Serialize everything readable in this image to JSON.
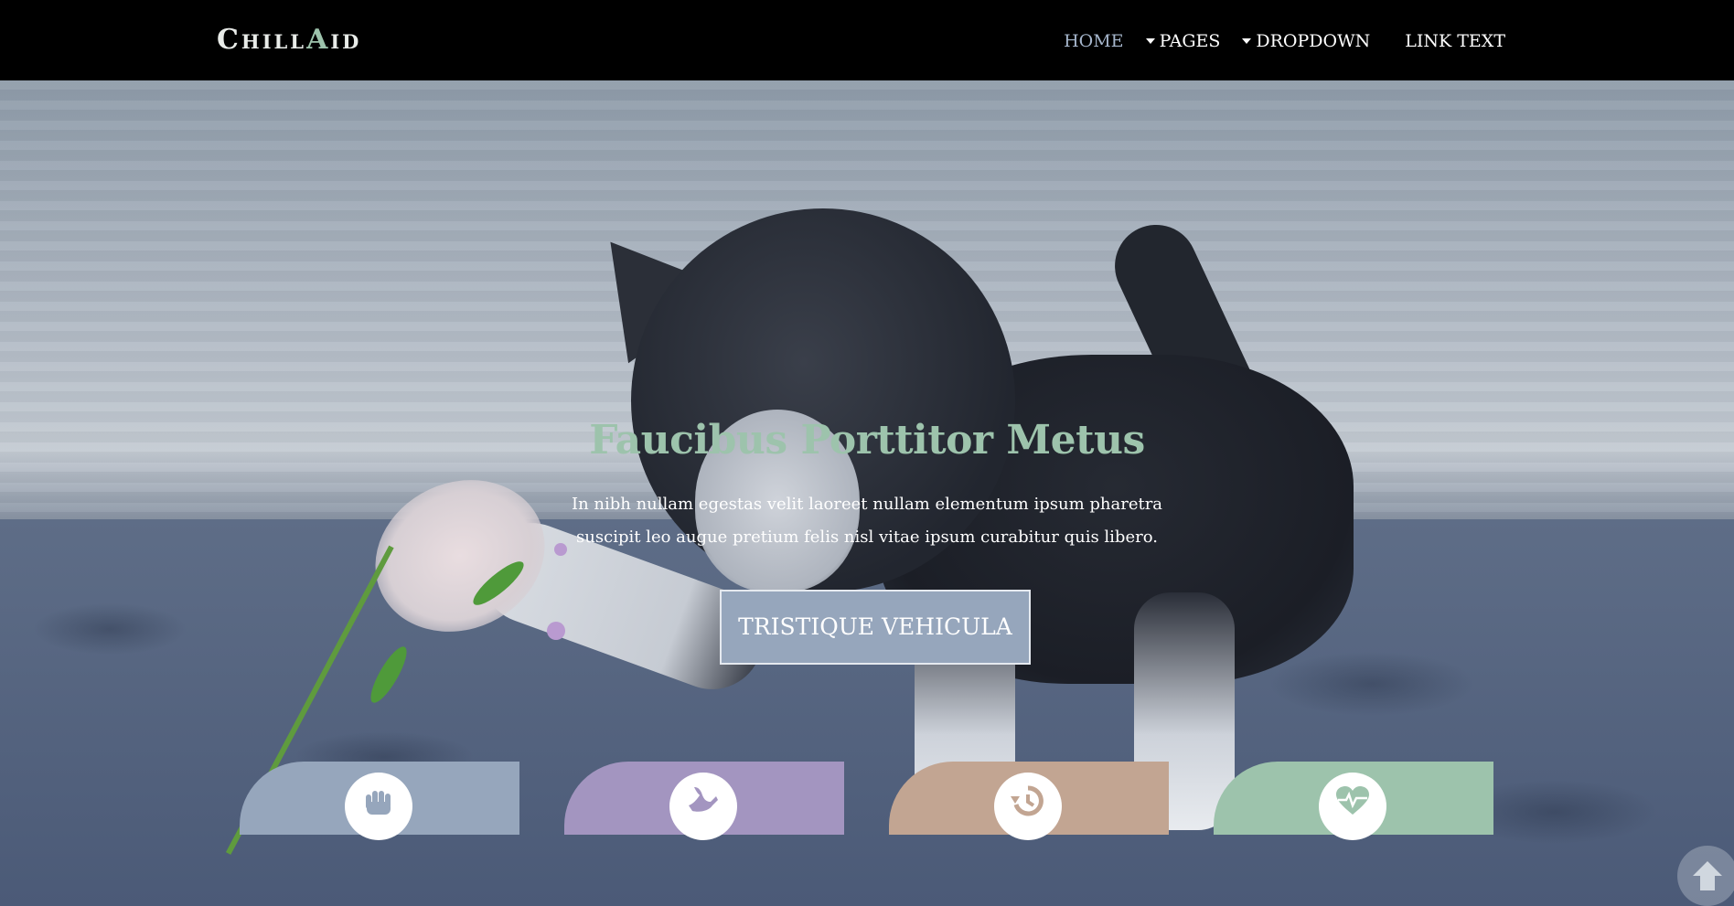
{
  "brand": {
    "logo_main": "Chill",
    "logo_accent": "A",
    "logo_rest": "id"
  },
  "nav": {
    "items": [
      {
        "label": "HOME",
        "active": true,
        "dropdown": false
      },
      {
        "label": "PAGES",
        "active": false,
        "dropdown": true
      },
      {
        "label": "DROPDOWN",
        "active": false,
        "dropdown": true
      },
      {
        "label": "LINK TEXT",
        "active": false,
        "dropdown": false
      }
    ]
  },
  "hero": {
    "title": "Faucibus Porttitor Metus",
    "text": "In nibh nullam egestas velit laoreet nullam elementum ipsum pharetra suscipit leo augue pretium felis nisl vitae ipsum curabitur quis libero.",
    "button_label": "TRISTIQUE VEHICULA"
  },
  "features": [
    {
      "icon": "hand-icon",
      "color": "#96a6bc"
    },
    {
      "icon": "dove-icon",
      "color": "#a395c0"
    },
    {
      "icon": "history-icon",
      "color": "#c2a592"
    },
    {
      "icon": "heartbeat-icon",
      "color": "#9dc3ac"
    }
  ],
  "colors": {
    "accent_green": "#9dc3ac",
    "nav_active": "#a6b6cc",
    "button_bg": "#96a6bc"
  },
  "scroll_top_icon": "arrow-up-icon"
}
